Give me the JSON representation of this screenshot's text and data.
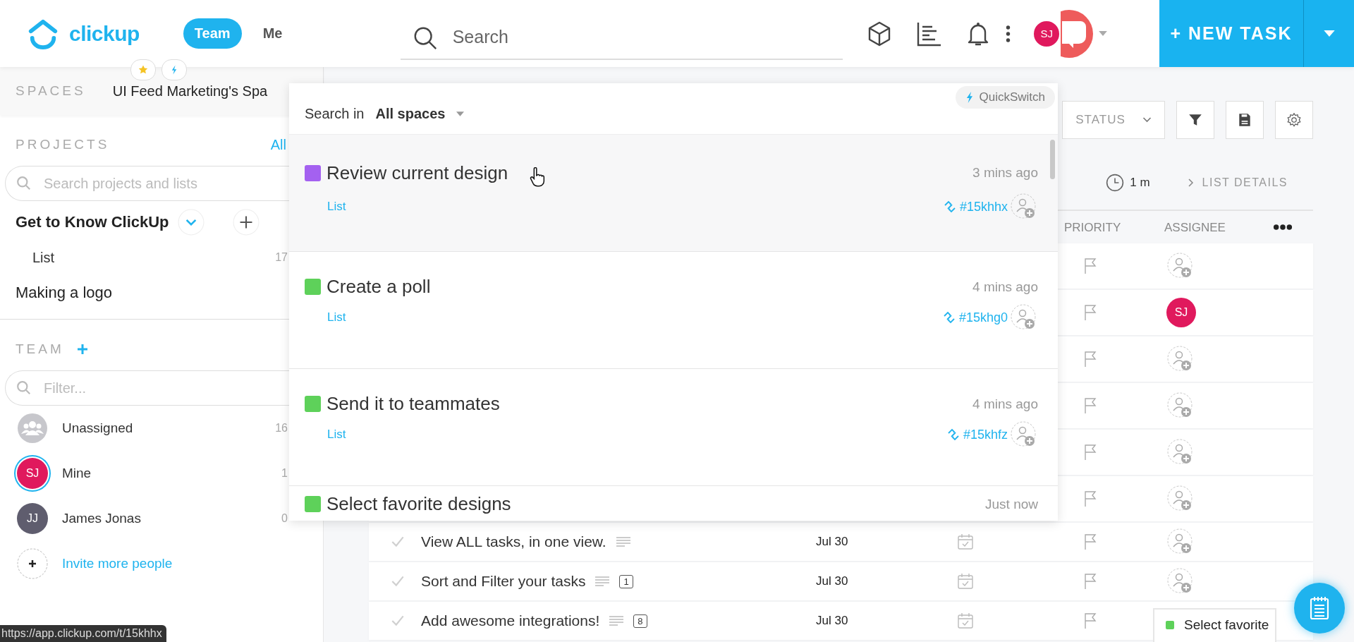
{
  "header": {
    "logo": "clickup",
    "tabs": [
      {
        "label": "Team",
        "selected": true
      },
      {
        "label": "Me",
        "selected": false
      }
    ],
    "search": {
      "placeholder": "Search"
    },
    "user_avatar": "SJ",
    "new_task_button": "+ NEW TASK"
  },
  "sidebar": {
    "spaces_label": "SPACES",
    "space_name": "UI Feed Marketing's Spa",
    "projects": {
      "title": "PROJECTS",
      "all_link": "All",
      "search": {
        "placeholder": "Search projects and lists"
      },
      "items": [
        {
          "name": "Get to Know ClickUp",
          "selected": true,
          "children": [
            {
              "name": "List",
              "count": "17"
            }
          ]
        },
        {
          "name": "Making a logo",
          "selected": false
        }
      ]
    },
    "team": {
      "title": "TEAM",
      "filter": {
        "placeholder": "Filter..."
      },
      "members": [
        {
          "name": "Unassigned",
          "kind": "group",
          "count": "16",
          "selected": false
        },
        {
          "name": "Mine",
          "kind": "user",
          "initials": "SJ",
          "color": "#e0195d",
          "count": "1",
          "selected": true
        },
        {
          "name": "James Jonas",
          "kind": "user",
          "initials": "JJ",
          "color": "#5f5d6e",
          "count": "0",
          "selected": false
        }
      ],
      "invite": "Invite more people"
    }
  },
  "status_url": "https://app.clickup.com/t/15khhx",
  "toolbar": {
    "status": "STATUS",
    "time": "1 m",
    "list_details": "LIST DETAILS"
  },
  "table": {
    "columns": [
      "PRIORITY",
      "ASSIGNEE"
    ],
    "rows": [
      {
        "assigned": false
      },
      {
        "assigned": true,
        "initials": "SJ"
      },
      {
        "assigned": false
      },
      {
        "assigned": false
      },
      {
        "assigned": false
      },
      {
        "assigned": false
      },
      {
        "name": "View ALL tasks, in one view.",
        "description": true,
        "date": "Jul 30",
        "assigned": false
      },
      {
        "name": "Sort and Filter your tasks",
        "description": true,
        "subtasks": "1",
        "date": "Jul 30",
        "assigned": false
      },
      {
        "name": "Add awesome integrations!",
        "description": true,
        "subtasks": "8",
        "date": "Jul 30"
      }
    ]
  },
  "quickswitch": {
    "scope_label": "Search in **All spaces**",
    "badge": "QuickSwitch",
    "results": [
      {
        "title": "Review current design",
        "list": "List",
        "time": "3 mins ago",
        "id": "#15khhx",
        "color": "#a461f0",
        "selected": true
      },
      {
        "title": "Create a poll",
        "list": "List",
        "time": "4 mins ago",
        "id": "#15khg0",
        "color": "#5ed15a",
        "selected": false
      },
      {
        "title": "Send it to teammates",
        "list": "List",
        "time": "4 mins ago",
        "id": "#15khfz",
        "color": "#5ed15a",
        "selected": false
      },
      {
        "title": "Select favorite designs",
        "time": "Just now",
        "color": "#5ed15a",
        "selected": false
      }
    ]
  },
  "toast": {
    "text": "Select favorite",
    "color": "#5ed15a"
  }
}
